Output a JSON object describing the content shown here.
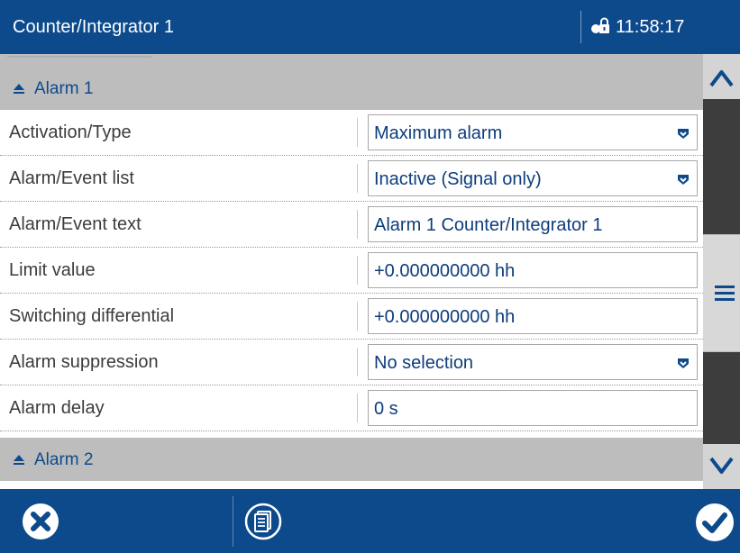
{
  "header": {
    "title": "Counter/Integrator 1",
    "lock_icon": "lock-user-icon",
    "time": "11:58:17"
  },
  "sections": {
    "alarm1": {
      "label": "Alarm 1",
      "icon": "collapse-triangle-icon"
    },
    "alarm2": {
      "label": "Alarm 2",
      "icon": "collapse-triangle-icon"
    }
  },
  "rows": [
    {
      "label": "Activation/Type",
      "value": "Maximum alarm",
      "kind": "dropdown"
    },
    {
      "label": "Alarm/Event list",
      "value": "Inactive (Signal only)",
      "kind": "dropdown"
    },
    {
      "label": "Alarm/Event text",
      "value": "Alarm 1 Counter/Integrator 1",
      "kind": "text"
    },
    {
      "label": "Limit value",
      "value": "+0.000000000 hh",
      "kind": "text"
    },
    {
      "label": "Switching differential",
      "value": "+0.000000000 hh",
      "kind": "text"
    },
    {
      "label": "Alarm suppression",
      "value": "No selection",
      "kind": "dropdown"
    },
    {
      "label": "Alarm delay",
      "value": "0 s",
      "kind": "text"
    }
  ],
  "scrollbar": {
    "up_icon": "chevron-up-icon",
    "handle_icon": "hamburger-icon",
    "down_icon": "chevron-down-icon"
  },
  "footer": {
    "cancel_icon": "cancel-x-icon",
    "list_icon": "document-list-icon",
    "confirm_icon": "checkmark-icon"
  },
  "colors": {
    "brand_blue": "#0d4a8c",
    "section_gray": "#bdbdbd",
    "value_text": "#0d3d7c"
  }
}
